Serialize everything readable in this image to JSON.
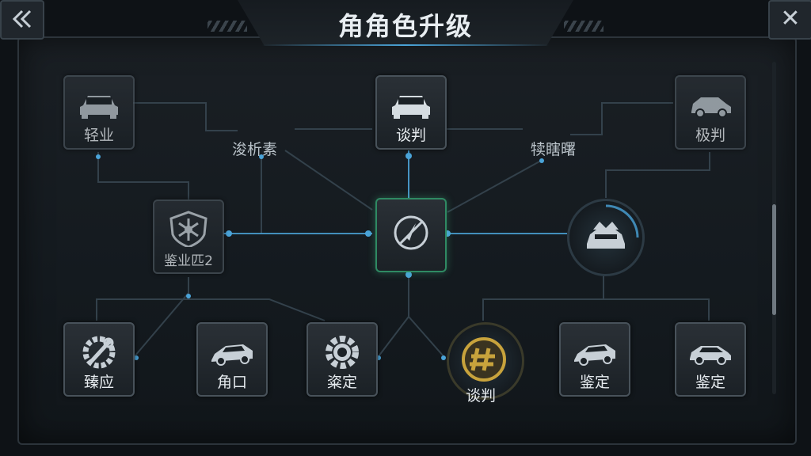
{
  "header": {
    "title": "角角色升级",
    "back_icon": "double-chevron-left-icon",
    "close_label": "✕"
  },
  "colors": {
    "link": "#3a4a56",
    "link_active": "#4aa3d8",
    "gold": "#c8a33c",
    "accent_green": "#2f8a63"
  },
  "nodes": {
    "top_left": {
      "label": "轻业",
      "icon": "sedan-front-icon"
    },
    "top_center": {
      "label": "谈判",
      "icon": "sedan-front-icon"
    },
    "top_right": {
      "label": "极判",
      "icon": "suv-side-icon"
    },
    "shield": {
      "label": "鉴业匹2",
      "icon": "shield-emblem-icon"
    },
    "center": {
      "label": "",
      "icon": "no-compass-icon"
    },
    "ring": {
      "label": "",
      "icon": "car-wings-icon"
    },
    "bottom_1": {
      "label": "臻应",
      "icon": "wrench-gear-icon"
    },
    "bottom_2": {
      "label": "角口",
      "icon": "sports-car-icon"
    },
    "bottom_3": {
      "label": "粢定",
      "icon": "gear-icon"
    },
    "bottom_4": {
      "label": "谈判",
      "icon": "gold-emblem-icon"
    },
    "bottom_5": {
      "label": "鉴定",
      "icon": "sports-car-icon"
    },
    "bottom_6": {
      "label": "鉴定",
      "icon": "hatchback-side-icon"
    }
  },
  "floating_labels": {
    "left": "浚析素",
    "right": "犊瞎曙"
  }
}
